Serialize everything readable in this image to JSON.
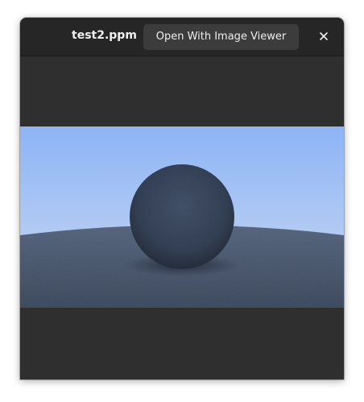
{
  "window": {
    "title": "test2.ppm",
    "open_with_label": "Open With Image Viewer",
    "close_icon": "close-icon"
  },
  "image": {
    "description_icon": "rendered-image",
    "colors": {
      "sky_top": "#8db4f6",
      "sky_bottom": "#c8d9ee",
      "ground": "#3c4a60",
      "sphere": "#2c3a4f"
    }
  }
}
